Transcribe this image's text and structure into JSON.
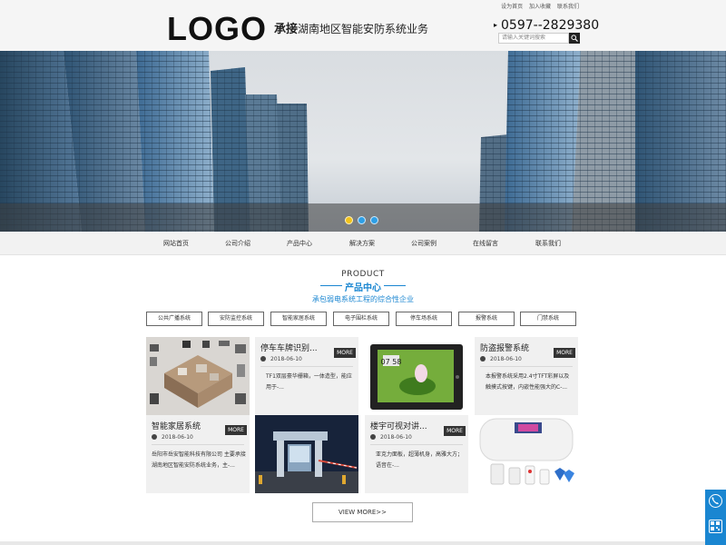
{
  "header": {
    "logo": "LOGO",
    "slogan_bold": "承接",
    "slogan_rest": "湖南地区智能安防系统业务",
    "top_links": [
      "设为首页",
      "加入收藏",
      "联系我们"
    ],
    "phone": "0597--2829380",
    "search_placeholder": "请输入关键词搜索"
  },
  "banner": {
    "slides": 3,
    "active_slide": 1
  },
  "nav": [
    "网站首页",
    "公司介绍",
    "产品中心",
    "解决方案",
    "公司案例",
    "在线留言",
    "联系我们"
  ],
  "section": {
    "title_en": "PRODUCT",
    "title_cn": "产品中心",
    "subtitle": "承包弱电系统工程的综合性企业"
  },
  "tabs": [
    "公共广播系统",
    "安防监控系统",
    "智能家居系统",
    "电子围栏系统",
    "停车场系统",
    "报警系统",
    "门禁系统"
  ],
  "products": [
    {
      "title": "智能家居系统",
      "more": "MORE",
      "date": "2018-06-10",
      "desc": "岳阳市岳安智能科技有限公司 主要承接湖南地区智能安防系统业务，主-..."
    },
    {
      "title": "停车车牌识别...",
      "more": "MORE",
      "date": "2018-06-10",
      "desc": "TF1双层豪华栅箱，一体造型，能应用于-..."
    },
    {
      "title": "楼宇可视对讲...",
      "more": "MORE",
      "date": "2018-06-10",
      "desc": "亚克力面板，超薄机身，高雅大方；语音在-..."
    },
    {
      "title": "防盗报警系统",
      "more": "MORE",
      "date": "2018-06-10",
      "desc": "本报警系统采用2.4寸TFT彩屏以及触摸式按键，内嵌性能强大的C-..."
    }
  ],
  "view_more": "VIEW MORE>>",
  "colors": {
    "accent": "#1a86d1",
    "dark": "#333333",
    "slider_active": "#f2c21b",
    "slider_dot": "#2e9fe6"
  },
  "side_icons": [
    "phone-icon",
    "qrcode-icon"
  ]
}
